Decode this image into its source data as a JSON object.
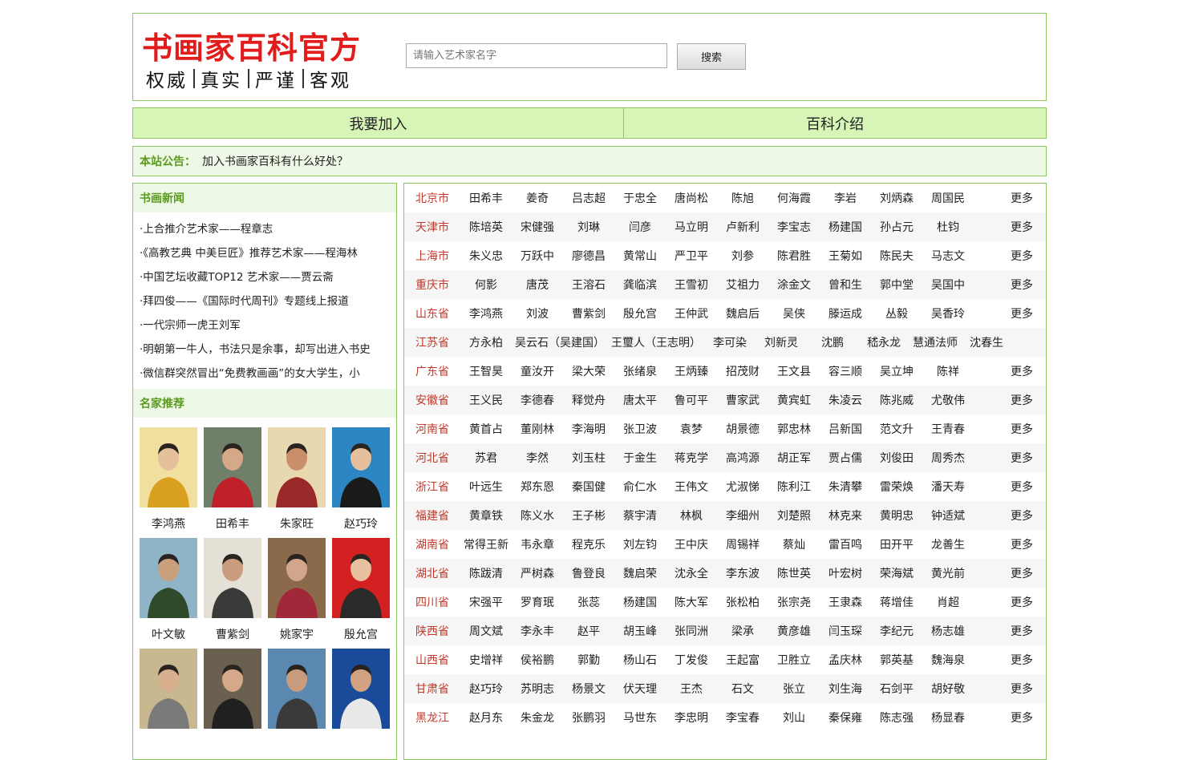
{
  "header": {
    "title": "书画家百科官方",
    "subtitle": [
      "权威",
      "真实",
      "严谨",
      "客观"
    ]
  },
  "search": {
    "placeholder": "请输入艺术家名字",
    "button": "搜索"
  },
  "nav": [
    {
      "label": "我要加入"
    },
    {
      "label": "百科介绍"
    }
  ],
  "notice": {
    "label": "本站公告：",
    "text": "加入书画家百科有什么好处？"
  },
  "news": {
    "title": "书画新闻",
    "items": [
      "·上合推介艺术家——程章志",
      "·《高教艺典 中美巨匠》推荐艺术家——程海林",
      "·中国艺坛收藏TOP12 艺术家——贾云斋",
      "·拜四俊——《国际时代周刊》专题线上报道",
      "·一代宗师一虎王刘军",
      "·明朝第一牛人，书法只是余事，却写出进入书史",
      "·微信群突然冒出“免费教画画”的女大学生，小"
    ]
  },
  "recommend": {
    "title": "名家推荐",
    "people": [
      {
        "name": "李鸿燕",
        "bg": "#f1dfa0",
        "fg": "#d9a020",
        "face": "#e6c09a"
      },
      {
        "name": "田希丰",
        "bg": "#6f7f6a",
        "fg": "#c0202a",
        "face": "#d5a889"
      },
      {
        "name": "朱家旺",
        "bg": "#e8d8b0",
        "fg": "#9a2a2a",
        "face": "#c88f6a"
      },
      {
        "name": "赵巧玲",
        "bg": "#2c86c4",
        "fg": "#1a1a1a",
        "face": "#e6bf9c"
      },
      {
        "name": "叶文敏",
        "bg": "#8fb4c8",
        "fg": "#2e4a2a",
        "face": "#c9a07c"
      },
      {
        "name": "曹紫剑",
        "bg": "#e4e0d6",
        "fg": "#3a3a3a",
        "face": "#c89c7c"
      },
      {
        "name": "姚家宇",
        "bg": "#8a6a4a",
        "fg": "#a02838",
        "face": "#d2a68a"
      },
      {
        "name": "殷允宫",
        "bg": "#d42020",
        "fg": "#2a2a2a",
        "face": "#e8c0a0"
      },
      {
        "name": "",
        "bg": "#c8b890",
        "fg": "#7a7a7a",
        "face": "#d8b08e"
      },
      {
        "name": "",
        "bg": "#6a6050",
        "fg": "#202020",
        "face": "#d4a888"
      },
      {
        "name": "",
        "bg": "#5a88b0",
        "fg": "#3a3a3a",
        "face": "#c89c7c"
      },
      {
        "name": "",
        "bg": "#1a4a9a",
        "fg": "#e8e8e8",
        "face": "#d2a282"
      }
    ]
  },
  "provinces": {
    "more": "更多",
    "rows": [
      {
        "name": "北京市",
        "people": [
          "田希丰",
          "姜奇",
          "吕志超",
          "于忠全",
          "唐尚松",
          "陈旭",
          "何海霞",
          "李岩",
          "刘炳森",
          "周国民"
        ]
      },
      {
        "name": "天津市",
        "people": [
          "陈培英",
          "宋健强",
          "刘琳",
          "闫彦",
          "马立明",
          "卢新利",
          "李宝志",
          "杨建国",
          "孙占元",
          "杜钧"
        ]
      },
      {
        "name": "上海市",
        "people": [
          "朱义忠",
          "万跃中",
          "廖德昌",
          "黄常山",
          "严卫平",
          "刘参",
          "陈君胜",
          "王菊如",
          "陈民夫",
          "马志文"
        ]
      },
      {
        "name": "重庆市",
        "people": [
          "何影",
          "唐茂",
          "王溶石",
          "龚临滨",
          "王雪初",
          "艾祖力",
          "涂金文",
          "曾和生",
          "郭中堂",
          "吴国中"
        ]
      },
      {
        "name": "山东省",
        "people": [
          "李鸿燕",
          "刘波",
          "曹紫剑",
          "殷允宫",
          "王仲武",
          "魏启后",
          "吴侠",
          "滕运成",
          "丛毅",
          "吴香玲"
        ]
      },
      {
        "name": "江苏省",
        "people": [
          "方永柏",
          "吴云石（吴建国）",
          "王璽人（王志明）",
          "李可染",
          "刘新灵",
          "沈鹏",
          "嵇永龙",
          "慧通法师",
          "沈春生"
        ],
        "noMore": true
      },
      {
        "name": "广东省",
        "people": [
          "王智昊",
          "童汝开",
          "梁大荣",
          "张绪泉",
          "王炳臻",
          "招茂财",
          "王文县",
          "容三顺",
          "吴立坤",
          "陈祥"
        ]
      },
      {
        "name": "安徽省",
        "people": [
          "王义民",
          "李德春",
          "释觉舟",
          "唐太平",
          "鲁可平",
          "曹家武",
          "黄宾虹",
          "朱凌云",
          "陈兆威",
          "尤敬伟"
        ]
      },
      {
        "name": "河南省",
        "people": [
          "黄首占",
          "董刚林",
          "李海明",
          "张卫波",
          "袁梦",
          "胡景德",
          "郭忠林",
          "吕新国",
          "范文升",
          "王青春"
        ]
      },
      {
        "name": "河北省",
        "people": [
          "苏君",
          "李然",
          "刘玉柱",
          "于金生",
          "蒋克学",
          "高鸿源",
          "胡正军",
          "贾占儒",
          "刘俊田",
          "周秀杰"
        ]
      },
      {
        "name": "浙江省",
        "people": [
          "叶远生",
          "郑东恩",
          "秦国健",
          "俞仁水",
          "王伟文",
          "尤淑悌",
          "陈利江",
          "朱清攀",
          "雷荣焕",
          "潘天寿"
        ]
      },
      {
        "name": "福建省",
        "people": [
          "黄章铁",
          "陈义水",
          "王子彬",
          "蔡宇清",
          "林枫",
          "李细州",
          "刘楚照",
          "林克来",
          "黄明忠",
          "钟适斌"
        ]
      },
      {
        "name": "湖南省",
        "people": [
          "常得王新",
          "韦永章",
          "程克乐",
          "刘左钧",
          "王中庆",
          "周锡祥",
          "蔡灿",
          "雷百鸣",
          "田开平",
          "龙善生"
        ]
      },
      {
        "name": "湖北省",
        "people": [
          "陈跋清",
          "严树森",
          "鲁登良",
          "魏启荣",
          "沈永全",
          "李东波",
          "陈世英",
          "叶宏树",
          "荣海斌",
          "黄光前"
        ]
      },
      {
        "name": "四川省",
        "people": [
          "宋强平",
          "罗育珉",
          "张蕊",
          "杨建国",
          "陈大军",
          "张松柏",
          "张宗尧",
          "王隶森",
          "蒋增佳",
          "肖超"
        ]
      },
      {
        "name": "陕西省",
        "people": [
          "周文斌",
          "李永丰",
          "赵平",
          "胡玉峰",
          "张同洲",
          "梁承",
          "黄彦雄",
          "闫玉琛",
          "李纪元",
          "杨志雄"
        ]
      },
      {
        "name": "山西省",
        "people": [
          "史增祥",
          "侯裕鹏",
          "郭勤",
          "杨山石",
          "丁发俊",
          "王起富",
          "卫胜立",
          "孟庆林",
          "郭英基",
          "魏海泉"
        ]
      },
      {
        "name": "甘肃省",
        "people": [
          "赵巧玲",
          "苏明志",
          "杨景文",
          "伏天理",
          "王杰",
          "石文",
          "张立",
          "刘生海",
          "石剑平",
          "胡好敬"
        ]
      },
      {
        "name": "黑龙江",
        "people": [
          "赵月东",
          "朱金龙",
          "张鹏羽",
          "马世东",
          "李忠明",
          "李宝春",
          "刘山",
          "秦保雍",
          "陈志强",
          "杨显春"
        ]
      }
    ]
  }
}
